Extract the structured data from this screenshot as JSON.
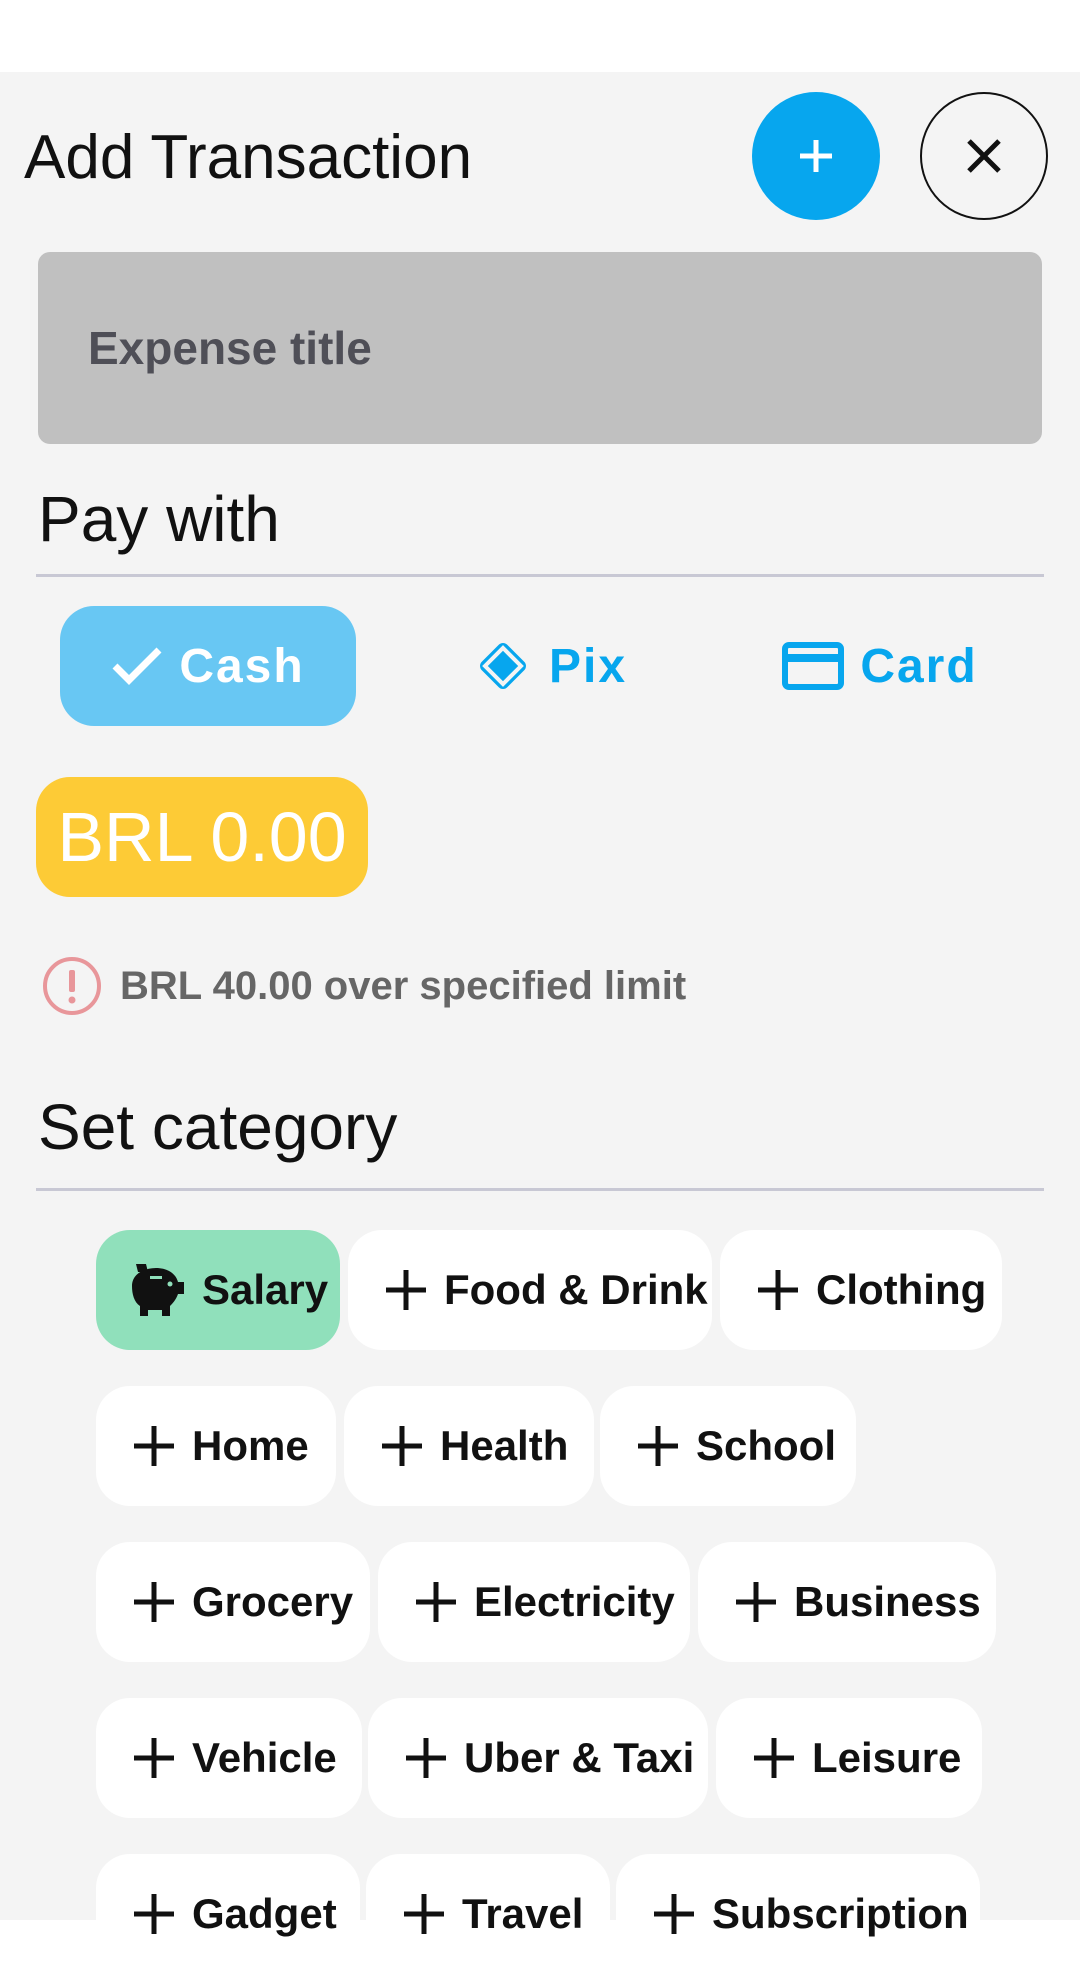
{
  "header": {
    "title": "Add Transaction",
    "add_icon": "plus-icon",
    "close_icon": "close-icon"
  },
  "title_input": {
    "placeholder": "Expense title",
    "value": ""
  },
  "payment": {
    "heading": "Pay with",
    "options": [
      {
        "label": "Cash",
        "icon": "check-icon",
        "selected": true
      },
      {
        "label": "Pix",
        "icon": "pix-icon",
        "selected": false
      },
      {
        "label": "Card",
        "icon": "credit-card-icon",
        "selected": false
      }
    ]
  },
  "amount": {
    "display": "BRL 0.00"
  },
  "warning": {
    "text": "BRL  40.00 over specified limit",
    "icon": "exclamation-icon"
  },
  "category": {
    "heading": "Set category",
    "chips": [
      {
        "label": "Salary",
        "icon": "piggy-bank-icon",
        "selected": true
      },
      {
        "label": "Food & Drink",
        "icon": "plus-icon",
        "selected": false
      },
      {
        "label": "Clothing",
        "icon": "plus-icon",
        "selected": false
      },
      {
        "label": "Home",
        "icon": "plus-icon",
        "selected": false
      },
      {
        "label": "Health",
        "icon": "plus-icon",
        "selected": false
      },
      {
        "label": "School",
        "icon": "plus-icon",
        "selected": false
      },
      {
        "label": "Grocery",
        "icon": "plus-icon",
        "selected": false
      },
      {
        "label": "Electricity",
        "icon": "plus-icon",
        "selected": false
      },
      {
        "label": "Business",
        "icon": "plus-icon",
        "selected": false
      },
      {
        "label": "Vehicle",
        "icon": "plus-icon",
        "selected": false
      },
      {
        "label": "Uber & Taxi",
        "icon": "plus-icon",
        "selected": false
      },
      {
        "label": "Leisure",
        "icon": "plus-icon",
        "selected": false
      },
      {
        "label": "Gadget",
        "icon": "plus-icon",
        "selected": false
      },
      {
        "label": "Travel",
        "icon": "plus-icon",
        "selected": false
      },
      {
        "label": "Subscription",
        "icon": "plus-icon",
        "selected": false
      }
    ]
  },
  "colors": {
    "accent": "#07a6ee",
    "accent_selected": "#68c7f3",
    "amount_bg": "#fdcb36",
    "category_selected": "#90e0bb",
    "warning": "#e8969a"
  }
}
